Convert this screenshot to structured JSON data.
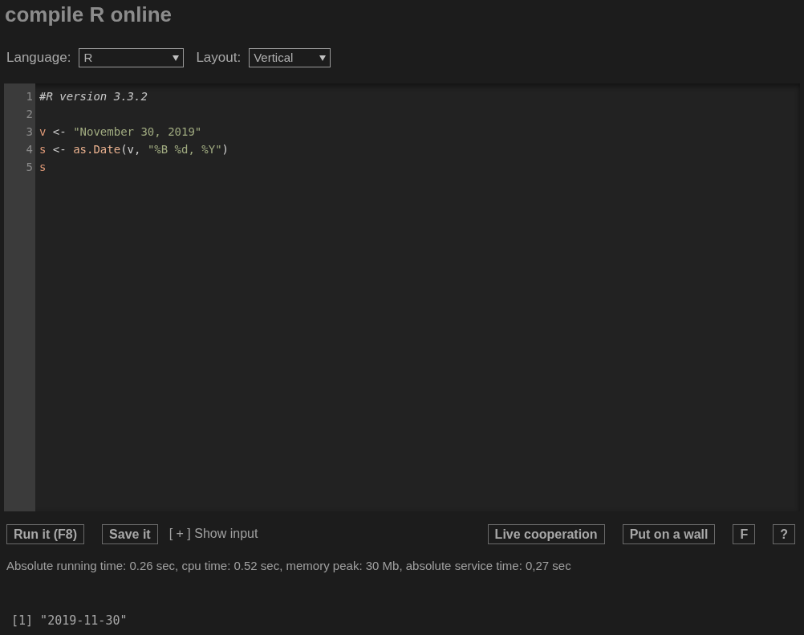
{
  "title": "compile R online",
  "controls": [
    {
      "label": "Language:",
      "value": "R"
    },
    {
      "label": "Layout:",
      "value": "Vertical"
    }
  ],
  "editor": {
    "lines": [
      {
        "number": "1",
        "tokens": [
          {
            "text": "#R version 3.3.2",
            "kind": "comment"
          }
        ]
      },
      {
        "number": "2"
      },
      {
        "number": "3",
        "tokens": [
          {
            "text": "v",
            "kind": "var"
          },
          {
            "text": " <- ",
            "kind": "op"
          },
          {
            "text": "\"November 30, 2019\"",
            "kind": "string"
          }
        ]
      },
      {
        "number": "4",
        "tokens": [
          {
            "text": "s",
            "kind": "var"
          },
          {
            "text": " <- ",
            "kind": "op"
          },
          {
            "text": "as.Date",
            "kind": "func"
          },
          {
            "text": "(v, ",
            "kind": "op"
          },
          {
            "text": "\"%B %d, %Y\"",
            "kind": "string"
          },
          {
            "text": ")",
            "kind": "op"
          }
        ]
      },
      {
        "number": "5",
        "tokens": [
          {
            "text": "s",
            "kind": "var"
          }
        ]
      }
    ]
  },
  "actions_left": [
    "Run it (F8)",
    "Save it"
  ],
  "show_input": "[ + ] Show input",
  "actions_right": [
    "Live cooperation",
    "Put on a wall",
    "F",
    "?"
  ],
  "stats": "Absolute running time: 0.26 sec, cpu time: 0.52 sec, memory peak: 30 Mb, absolute service time: 0,27 sec",
  "output": "[1] \"2019-11-30\""
}
